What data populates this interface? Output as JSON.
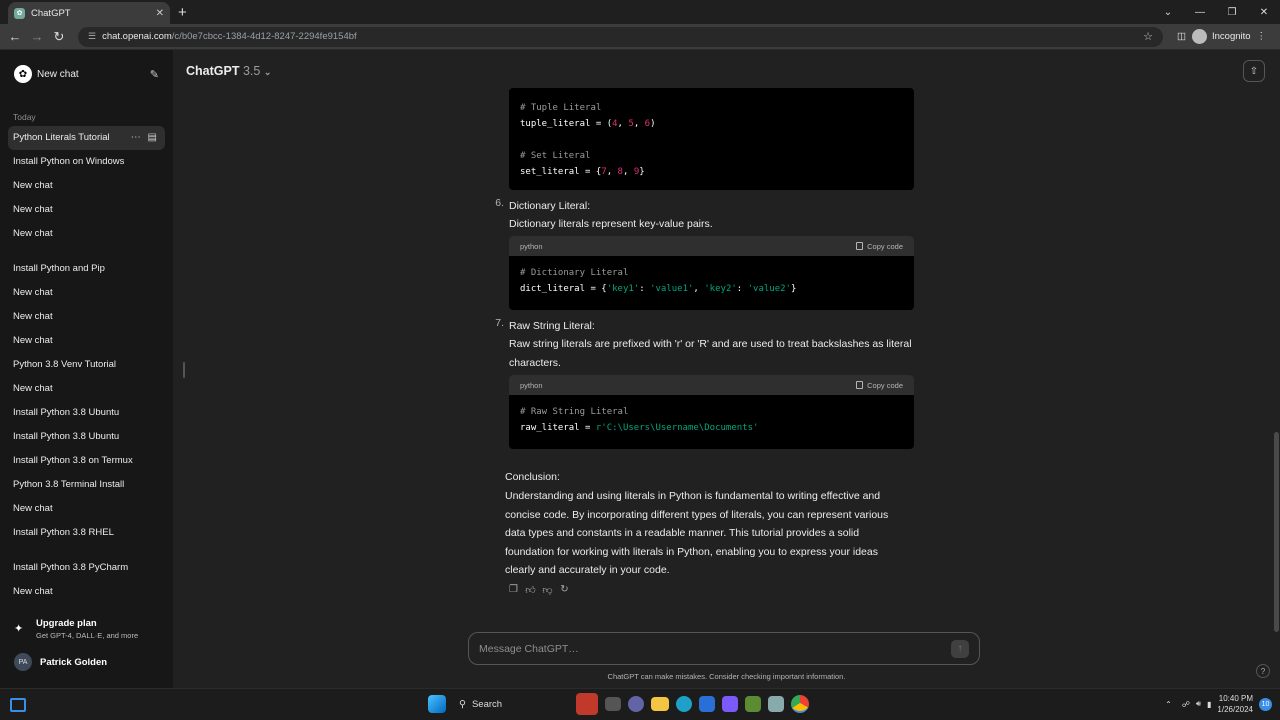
{
  "browser": {
    "tab_title": "ChatGPT",
    "url_host": "chat.openai.com",
    "url_path": "/c/b0e7cbcc-1384-4d12-8247-2294fe9154bf",
    "profile_label": "Incognito"
  },
  "sidebar": {
    "new_chat": "New chat",
    "sections": [
      {
        "title": "Today",
        "items": [
          "Python Literals Tutorial",
          "Install Python on Windows",
          "New chat",
          "New chat",
          "New chat"
        ]
      },
      {
        "title": "",
        "items": [
          "Install Python and Pip",
          "New chat",
          "New chat",
          "New chat",
          "Python 3.8 Venv Tutorial",
          "New chat",
          "Install Python 3.8 Ubuntu",
          "Install Python 3.8 Ubuntu",
          "Install Python 3.8 on Termux",
          "Python 3.8 Terminal Install",
          "New chat",
          "Install Python 3.8 RHEL"
        ]
      },
      {
        "title": "",
        "items": [
          "Install Python 3.8 PyCharm",
          "New chat"
        ]
      }
    ],
    "upgrade_title": "Upgrade plan",
    "upgrade_sub": "Get GPT-4, DALL·E, and more",
    "user_initials": "PA",
    "user_name": "Patrick Golden"
  },
  "header": {
    "model": "ChatGPT",
    "version": "3.5"
  },
  "content": {
    "item6_num": "6.",
    "item6_title": "Dictionary Literal:",
    "item6_desc": "Dictionary literals represent key-value pairs.",
    "item7_num": "7.",
    "item7_title": "Raw String Literal:",
    "item7_desc": "Raw string literals are prefixed with 'r' or 'R' and are used to treat backslashes as literal characters.",
    "code_lang": "python",
    "copy_label": "Copy code",
    "conclusion_title": "Conclusion:",
    "conclusion_body": "Understanding and using literals in Python is fundamental to writing effective and concise code. By incorporating different types of literals, you can represent various data types and constants in a readable manner. This tutorial provides a solid foundation for working with literals in Python, enabling you to express your ideas clearly and accurately in your code."
  },
  "code": {
    "tuple_comment": "# Tuple Literal",
    "tuple_var": "tuple_literal = (",
    "tuple_vals": [
      "4",
      "5",
      "6"
    ],
    "set_comment": "# Set Literal",
    "set_var": "set_literal = {",
    "set_vals": [
      "7",
      "8",
      "9"
    ],
    "dict_comment": "# Dictionary Literal",
    "dict_var": "dict_literal = {",
    "dict_k1": "'key1'",
    "dict_v1": "'value1'",
    "dict_k2": "'key2'",
    "dict_v2": "'value2'",
    "raw_comment": "# Raw String Literal",
    "raw_var": "raw_literal = ",
    "raw_val": "r'C:\\Users\\Username\\Documents'"
  },
  "composer": {
    "placeholder": "Message ChatGPT…",
    "disclaimer": "ChatGPT can make mistakes. Consider checking important information."
  },
  "taskbar": {
    "search_label": "Search",
    "time": "10:40 PM",
    "date": "1/26/2024",
    "notification_count": "10"
  }
}
